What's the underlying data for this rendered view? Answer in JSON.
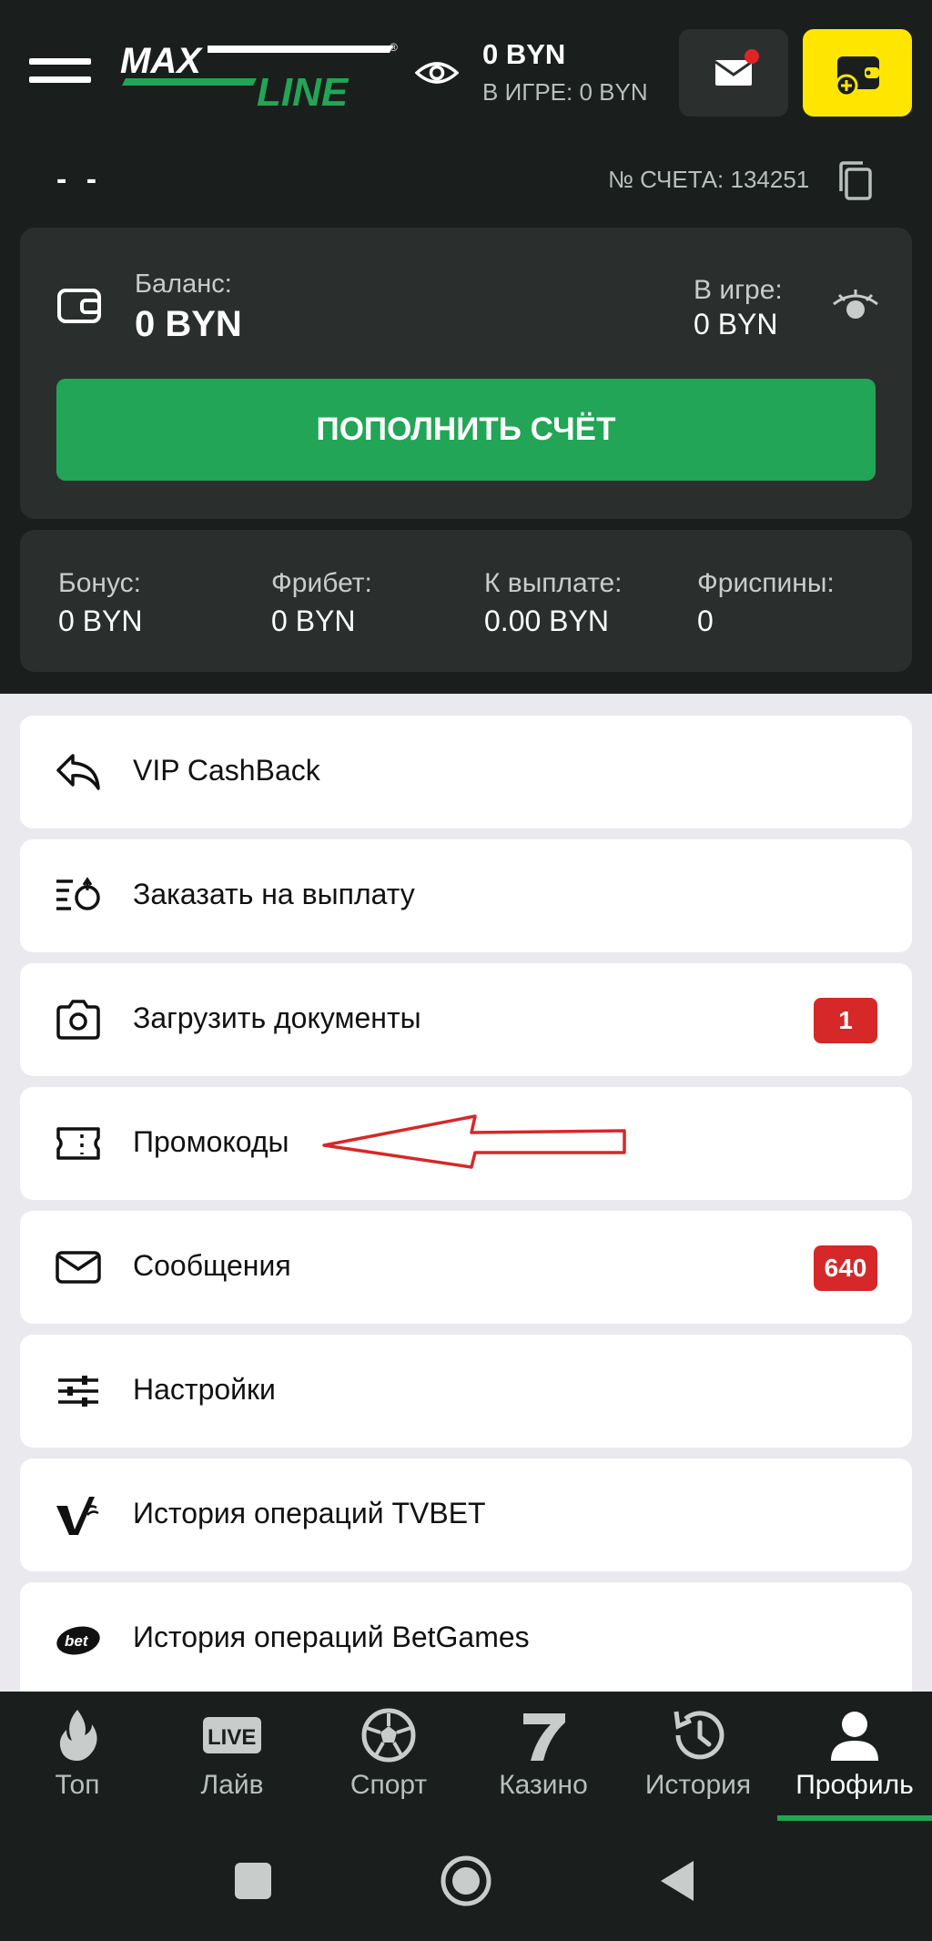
{
  "header": {
    "logo_text_max": "MAX",
    "logo_text_line": "LINE",
    "balance": "0 BYN",
    "in_game": "В ИГРЕ: 0 BYN",
    "account_number": "№ СЧЕТА: 134251",
    "user_name": "- -"
  },
  "balance_card": {
    "balance_label": "Баланс:",
    "balance_value": "0 BYN",
    "in_game_label": "В игре:",
    "in_game_value": "0 BYN",
    "topup_label": "ПОПОЛНИТЬ СЧЁТ"
  },
  "stats": [
    {
      "label": "Бонус:",
      "value": "0 BYN"
    },
    {
      "label": "Фрибет:",
      "value": "0 BYN"
    },
    {
      "label": "К выплате:",
      "value": "0.00 BYN"
    },
    {
      "label": "Фриспины:",
      "value": "0"
    }
  ],
  "menu": [
    {
      "label": "VIP CashBack",
      "icon": "reply-icon",
      "badge": ""
    },
    {
      "label": "Заказать на выплату",
      "icon": "withdraw-icon",
      "badge": ""
    },
    {
      "label": "Загрузить документы",
      "icon": "camera-icon",
      "badge": "1"
    },
    {
      "label": "Промокоды",
      "icon": "ticket-icon",
      "badge": ""
    },
    {
      "label": "Сообщения",
      "icon": "envelope-icon",
      "badge": "640"
    },
    {
      "label": "Настройки",
      "icon": "sliders-icon",
      "badge": ""
    },
    {
      "label": "История операций TVBET",
      "icon": "tvbet-icon",
      "badge": ""
    },
    {
      "label": "История операций BetGames",
      "icon": "betgames-icon",
      "badge": ""
    }
  ],
  "bottom_nav": [
    {
      "label": "Топ",
      "icon": "flame-icon"
    },
    {
      "label": "Лайв",
      "icon": "live-icon"
    },
    {
      "label": "Спорт",
      "icon": "soccer-ball-icon"
    },
    {
      "label": "Казино",
      "icon": "seven-icon"
    },
    {
      "label": "История",
      "icon": "history-icon"
    },
    {
      "label": "Профиль",
      "icon": "user-icon",
      "active": true
    }
  ],
  "colors": {
    "background": "#1a1f1d",
    "card": "#2a2f2d",
    "accent_green": "#22a556",
    "accent_yellow": "#ffe600",
    "badge_red": "#d62828"
  }
}
